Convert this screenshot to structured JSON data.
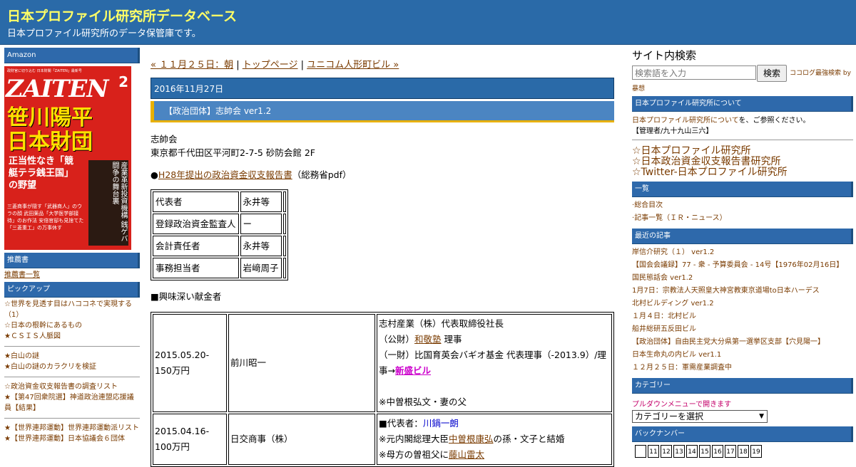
{
  "header": {
    "title": "日本プロファイル研究所データベース",
    "description": "日本プロファイル研究所のデータ保管庫です。"
  },
  "left": {
    "amazon_heading": "Amazon",
    "magazine": {
      "top_line": "政財官に切り込む 日本財閥「ZAITEN」最新号",
      "name": "ZAITEN",
      "issue": "2",
      "headline_line1": "笹川陽平",
      "headline_line2": "日本財団",
      "sub": "正当性なき「競艇テラ銭王国」の野望",
      "vertical": "産業革新投資機構 銭ゲバ闘争の舞台裏",
      "small": "三菱商事が隠す「武器商人」のウラの顔 武田薬品「大学医学部接待」のお作法 安倍官邸も見捨てた「三菱重工」の万事休す"
    },
    "recommend_heading": "推薦書",
    "recommend_link": "推薦書一覧",
    "pickup_heading": "ピックアップ",
    "pickup_group1": [
      "☆世界を見透す目はハココネで実現する（1）",
      "☆日本の根幹にあるもの",
      "★ＣＳＩＳ人脈図"
    ],
    "pickup_group2": [
      "★白山の謎",
      "★白山の謎のカラクリを検証"
    ],
    "pickup_group3": [
      "☆政治資金収支報告書の調査リスト",
      "★【第47回衆院選】神道政治連盟応援議員【結果】"
    ],
    "pickup_group4": [
      "★【世界連邦運動】世界連邦運動派リスト",
      "★【世界連邦運動】日本協議会６団体"
    ]
  },
  "main": {
    "nav": {
      "prev": "« １１月２５日：朝",
      "sep1": " | ",
      "top": "トップページ",
      "sep2": " | ",
      "next": "ユニコム人形町ビル »"
    },
    "date": "2016年11月27日",
    "title": "【政治団体】志帥会 ver1.2",
    "org_name": "志帥会",
    "address": "東京都千代田区平河町2-7-5 砂防会館 2F",
    "report_bullet": "●",
    "report_link": "H28年提出の政治資金収支報告書",
    "report_suffix": "（総務省pdf）",
    "roles": [
      {
        "role": "代表者",
        "name": "永井等"
      },
      {
        "role": "登録政治資金監査人",
        "name": "ー"
      },
      {
        "role": "会計責任者",
        "name": "永井等"
      },
      {
        "role": "事務担当者",
        "name": "岩﨑周子"
      }
    ],
    "interest_heading": "■興味深い献金者",
    "donors": [
      {
        "date": "2015.05.20-150万円",
        "name": "前川昭一",
        "line1": "志村産業（株）代表取締役社長",
        "line2_pre": "（公財）",
        "line2_link": "和敬塾",
        "line2_post": " 理事",
        "line3": "（一財）比国育英会バギオ基金 代表理事（-2013.9）/理事→",
        "line3_link": "新盛ビル",
        "line4": "※中曽根弘文・妻の父"
      },
      {
        "date": "2015.04.16-100万円",
        "name": "日交商事（株）",
        "line1_pre": "■代表者：",
        "line1_link": "川鍋一朗",
        "line2_pre": "※元内閣総理大臣",
        "line2_link": "中曽根康弘",
        "line2_post": "の孫・文子と結婚",
        "line3_pre": "※母方の曽祖父に",
        "line3_link": "藤山雷太"
      }
    ]
  },
  "right": {
    "search_title": "サイト内検索",
    "search_placeholder": "検索語を入力",
    "search_button": "検索",
    "cocolog": "ココログ最強検索 by",
    "muso": "暴想",
    "about_heading": "日本プロファイル研究所について",
    "about_link": "日本プロファイル研究所について",
    "about_suffix": "を、ご参照ください。",
    "admin": "【管理者/九十九山三六】",
    "big_links": [
      "☆日本プロファイル研究所",
      "☆日本政治資金収支報告書研究所",
      "☆Twitter-日本プロファイル研究所"
    ],
    "list_heading": "一覧",
    "list_items": [
      "総合目次",
      "記事一覧（ＩＲ・ニュース）"
    ],
    "recent_heading": "最近の記事",
    "recent_items": [
      "岸信介研究（１） ver1.2",
      "【国会会議録】77 - 衆 - 予算委員会 - 14号【1976年02月16日】",
      "国民態話会 ver1.2",
      "1月7日：宗教法人天照皇大神宮教東京道場to日本ハーデス",
      "北村ビルディング ver1.2",
      "１月４日：北村ビル",
      "船井総研五反田ビル",
      "【政治団体】自由民主党大分県第一選挙区支部【穴見陽一】",
      "日本生命丸の内ビル ver1.1",
      "１２月２５日：軍需産業調査中"
    ],
    "category_heading": "カテゴリー",
    "category_note": "プルダウンメニューで開きます",
    "category_select": "カテゴリーを選択",
    "backnumber_heading": "バックナンバー",
    "backnumbers": [
      "",
      "11",
      "12",
      "13",
      "14",
      "15",
      "16",
      "17",
      "18",
      "19"
    ]
  }
}
